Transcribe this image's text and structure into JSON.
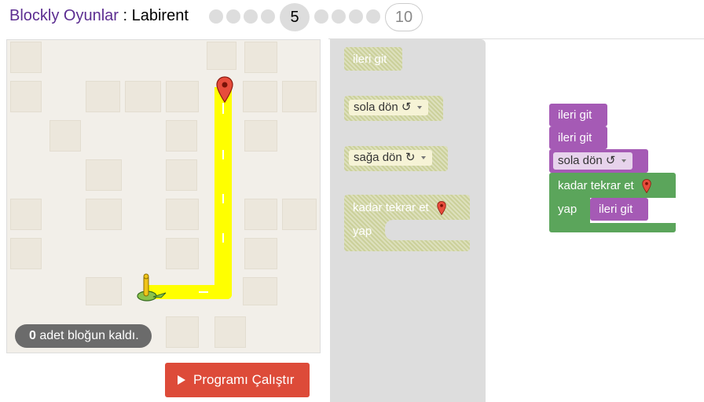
{
  "header": {
    "app_title": "Blockly Oyunlar",
    "separator": " : ",
    "game_title": "Labirent",
    "current_level": "5",
    "last_level": "10"
  },
  "maze": {
    "remaining_count": "0",
    "remaining_text": " adet bloğun kaldı."
  },
  "run_button": {
    "label": "Programı Çalıştır"
  },
  "toolbox": {
    "blocks": [
      {
        "label": "ileri git"
      },
      {
        "label": "sola dön ↺"
      },
      {
        "label": "sağa dön ↻"
      },
      {
        "label": "kadar tekrar et",
        "do_label": "yap"
      }
    ]
  },
  "workspace": {
    "blocks": [
      {
        "label": "ileri git"
      },
      {
        "label": "ileri git"
      },
      {
        "label": "sola dön ↺"
      },
      {
        "label": "kadar tekrar et",
        "do_label": "yap",
        "inner_label": "ileri git"
      }
    ]
  },
  "colors": {
    "app_title": "#5c2d91",
    "move_block": "#a55ab5",
    "loop_block": "#5ba55b",
    "path": "#ffff00",
    "run_button": "#dd4b39"
  }
}
